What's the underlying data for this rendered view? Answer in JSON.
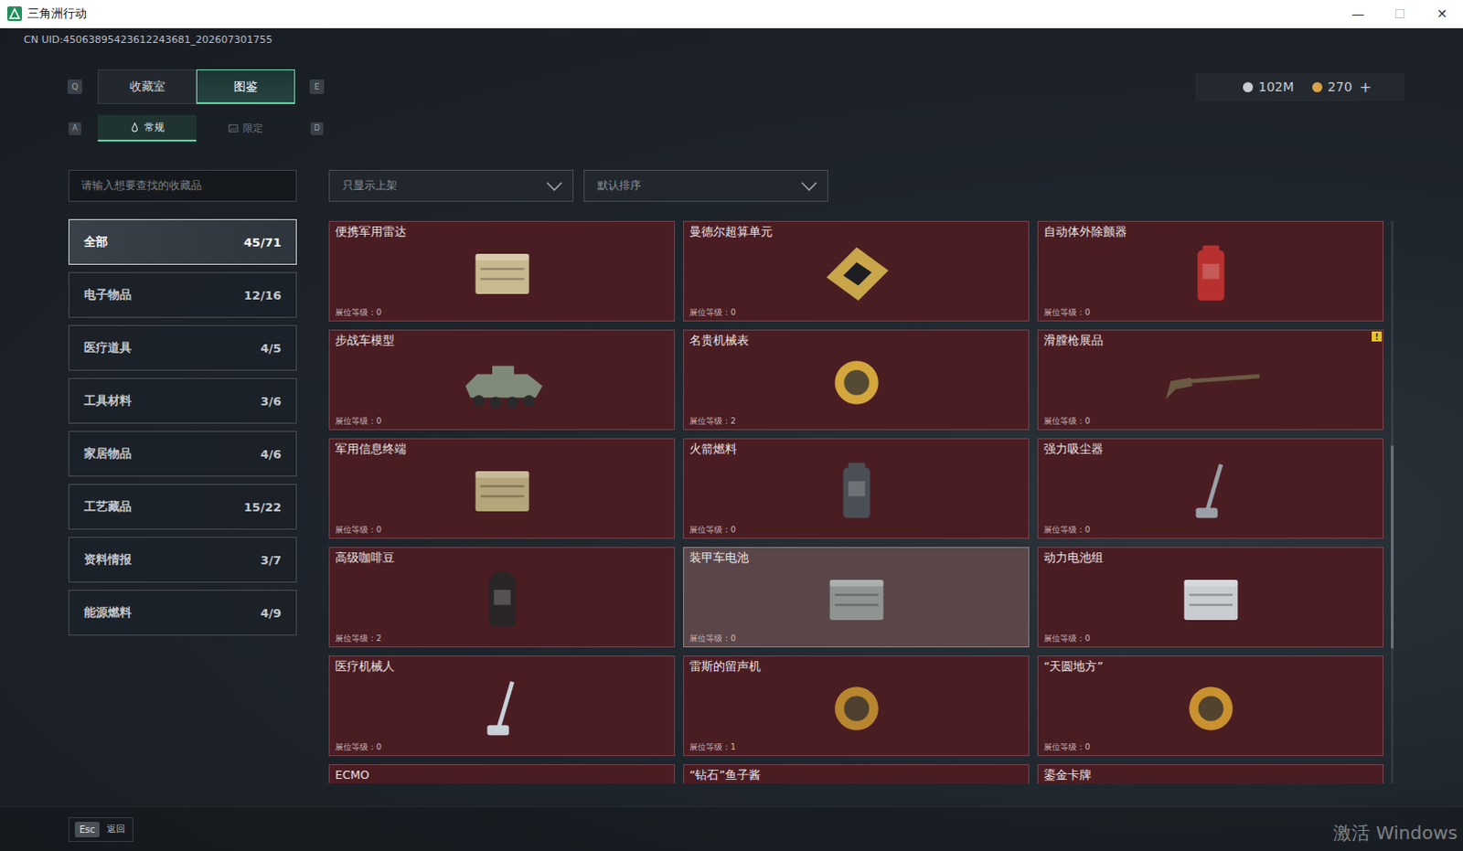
{
  "window": {
    "title": "三角洲行动",
    "controls": [
      {
        "label": "—",
        "disabled": false
      },
      {
        "label": "☐",
        "disabled": true
      },
      {
        "label": "✕",
        "disabled": false
      }
    ]
  },
  "uid": "CN UID:45063895423612243681_202607301755",
  "currency": [
    {
      "amount": "102M",
      "color": "#c9ccd0"
    },
    {
      "amount": "270",
      "color": "#d8a24a"
    }
  ],
  "currency_add": "+",
  "tabs": {
    "prev_key": "Q",
    "next_key": "E",
    "items": [
      {
        "label": "收藏室",
        "selected": false
      },
      {
        "label": "图鉴",
        "selected": true
      }
    ]
  },
  "subtabs": {
    "prev_key": "A",
    "next_key": "D",
    "items": [
      {
        "label": "常规",
        "selected": true
      },
      {
        "label": "限定",
        "selected": false
      }
    ]
  },
  "search": {
    "placeholder": "请输入想要查找的收藏品"
  },
  "filters": [
    {
      "label": "只显示上架"
    },
    {
      "label": "默认排序"
    }
  ],
  "sidebar": {
    "items": [
      {
        "label": "全部",
        "count": "45/71",
        "selected": true
      },
      {
        "label": "电子物品",
        "count": "12/16",
        "selected": false
      },
      {
        "label": "医疗道具",
        "count": "4/5",
        "selected": false
      },
      {
        "label": "工具材料",
        "count": "3/6",
        "selected": false
      },
      {
        "label": "家居物品",
        "count": "4/6",
        "selected": false
      },
      {
        "label": "工艺藏品",
        "count": "15/22",
        "selected": false
      },
      {
        "label": "资料情报",
        "count": "3/7",
        "selected": false
      },
      {
        "label": "能源燃料",
        "count": "4/9",
        "selected": false
      }
    ]
  },
  "level_label": "展位等级：",
  "cards": [
    {
      "name": "便携军用雷达",
      "level": "0",
      "highlighted": false
    },
    {
      "name": "曼德尔超算单元",
      "level": "0",
      "highlighted": false
    },
    {
      "name": "自动体外除颤器",
      "level": "0",
      "highlighted": false
    },
    {
      "name": "步战车模型",
      "level": "0",
      "highlighted": false
    },
    {
      "name": "名贵机械表",
      "level": "2",
      "highlighted": false
    },
    {
      "name": "滑膛枪展品",
      "level": "0",
      "highlighted": false,
      "badge": "!"
    },
    {
      "name": "军用信息终端",
      "level": "0",
      "highlighted": false
    },
    {
      "name": "火箭燃料",
      "level": "0",
      "highlighted": false
    },
    {
      "name": "强力吸尘器",
      "level": "0",
      "highlighted": false
    },
    {
      "name": "高级咖啡豆",
      "level": "2",
      "highlighted": false
    },
    {
      "name": "装甲车电池",
      "level": "0",
      "highlighted": true
    },
    {
      "name": "动力电池组",
      "level": "0",
      "highlighted": false
    },
    {
      "name": "医疗机械人",
      "level": "0",
      "highlighted": false
    },
    {
      "name": "雷斯的留声机",
      "level": "1",
      "highlighted": false
    },
    {
      "name": "“天圆地方”",
      "level": "0",
      "highlighted": false
    },
    {
      "name": "ECMO",
      "highlighted": false
    },
    {
      "name": "“钻石”鱼子酱",
      "highlighted": false
    },
    {
      "name": "鎏金卡牌",
      "highlighted": false
    }
  ],
  "scrollbar": {
    "offset": 0.4,
    "size": 0.36
  },
  "footer": {
    "key": "Esc",
    "label": "返回"
  },
  "watermark": "激活 Windows"
}
